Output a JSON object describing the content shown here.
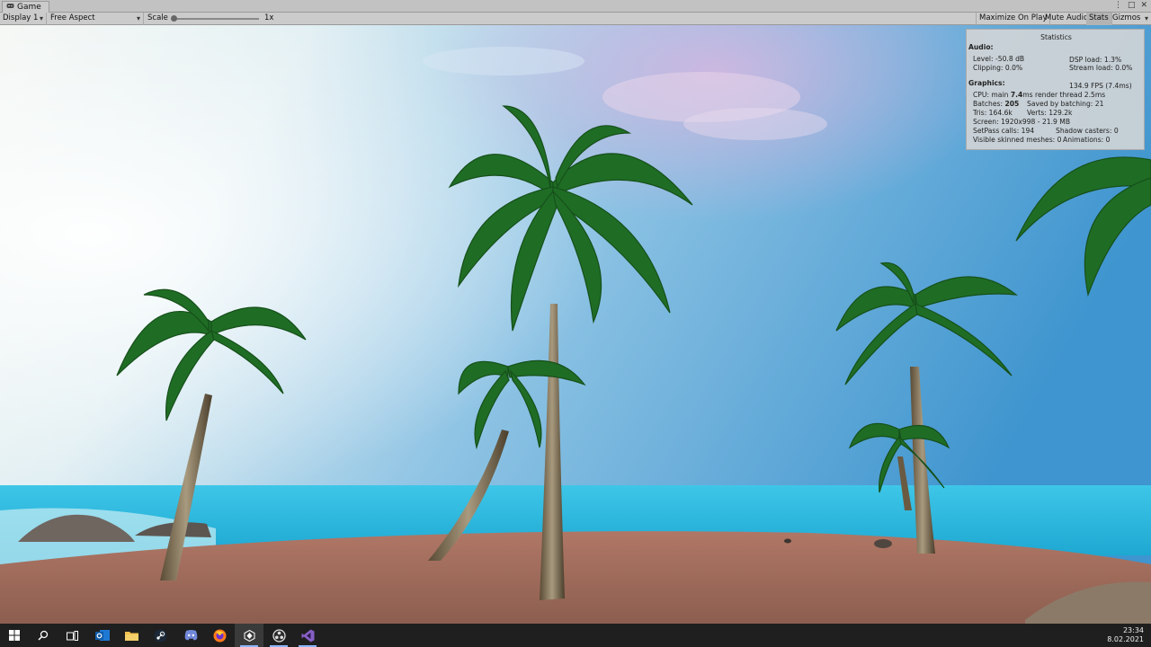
{
  "window": {
    "tab_label": "Game"
  },
  "toolbar": {
    "display": "Display 1",
    "aspect": "Free Aspect",
    "scale_label": "Scale",
    "scale_value": "1x",
    "maximize_on_play": "Maximize On Play",
    "mute_audio": "Mute Audio",
    "stats": "Stats",
    "gizmos": "Gizmos"
  },
  "stats": {
    "title": "Statistics",
    "audio_header": "Audio:",
    "level": "Level: -50.8 dB",
    "dsp_load": "DSP load: 1.3%",
    "clipping": "Clipping: 0.0%",
    "stream_load": "Stream load: 0.0%",
    "graphics_header": "Graphics:",
    "fps": "134.9 FPS (7.4ms)",
    "cpu_prefix": "CPU: main ",
    "cpu_main": "7.4",
    "cpu_suffix": "ms  render thread 2.5ms",
    "batches_prefix": "Batches: ",
    "batches": "205",
    "saved_batching": "Saved by batching: 21",
    "tris": "Tris: 164.6k",
    "verts": "Verts: 129.2k",
    "screen": "Screen: 1920x998 - 21.9 MB",
    "setpass": "SetPass calls: 194",
    "shadow_casters": "Shadow casters: 0",
    "skinned_meshes": "Visible skinned meshes: 0",
    "animations": "Animations: 0"
  },
  "taskbar": {
    "icons": [
      "windows-start-icon",
      "search-icon",
      "task-view-icon",
      "outlook-icon",
      "file-explorer-icon",
      "steam-icon",
      "discord-icon",
      "firefox-icon",
      "unity-icon",
      "obs-icon",
      "visual-studio-icon"
    ],
    "time": "23:34",
    "date": "8.02.2021"
  },
  "colors": {
    "sky_top": "#6aa9d8",
    "sky_bright": "#eef3f0",
    "sea": "#2fb8dc",
    "sand": "#9c6a5a",
    "palm_green": "#1e6b22",
    "taskbar": "#1f1f1f"
  }
}
